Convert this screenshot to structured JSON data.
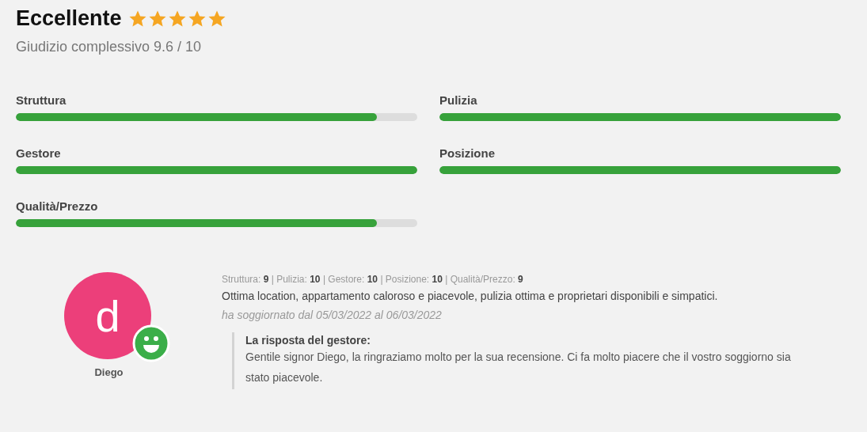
{
  "summary": {
    "title": "Eccellente",
    "stars": 5,
    "overall": "Giudizio complessivo 9.6 / 10"
  },
  "categories": [
    {
      "name": "Struttura",
      "level": 0.9
    },
    {
      "name": "Pulizia",
      "level": 1
    },
    {
      "name": "Gestore",
      "level": 1
    },
    {
      "name": "Posizione",
      "level": 1
    },
    {
      "name": "Qualità/Prezzo",
      "level": 0.9
    }
  ],
  "review": {
    "avatar_letter": "d",
    "author": "Diego",
    "scores": "Struttura: **9** | Pulizia: **10** | Gestore: **10** | Posizione: **10** | Qualità/Prezzo: **9**",
    "text": "Ottima location, appartamento caloroso e piacevole, pulizia ottima e proprietari disponibili e simpatici.",
    "stay": "ha soggiornato dal 05/03/2022 al 06/03/2022",
    "reply": {
      "title": "La risposta del gestore:",
      "text": "Gentile signor Diego, la ringraziamo molto per la sua recensione. Ci fa molto piacere che il vostro soggiorno sia stato piacevole."
    }
  }
}
